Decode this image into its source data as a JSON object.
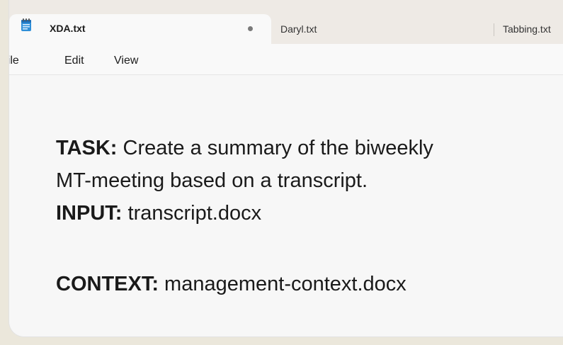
{
  "tabs": [
    {
      "label": "XDA.txt",
      "active": true,
      "unsaved": true
    },
    {
      "label": "Daryl.txt",
      "active": false
    },
    {
      "label": "Tabbing.txt",
      "active": false
    }
  ],
  "menu": {
    "file": "File",
    "edit": "Edit",
    "view": "View"
  },
  "document": {
    "task_label": "TASK:",
    "task_text_line1": " Create a summary of the biweekly",
    "task_text_line2": "MT-meeting based on a transcript.",
    "input_label": "INPUT:",
    "input_text": " transcript.docx",
    "context_label": "CONTEXT:",
    "context_text": " management-context.docx"
  },
  "colors": {
    "background": "#ebe7db",
    "tabbar": "#eeeae5",
    "editor": "#f7f7f7",
    "notepad_icon": "#2f8fd8"
  },
  "icons": {
    "app": "notepad-icon",
    "unsaved": "unsaved-dot-icon"
  }
}
